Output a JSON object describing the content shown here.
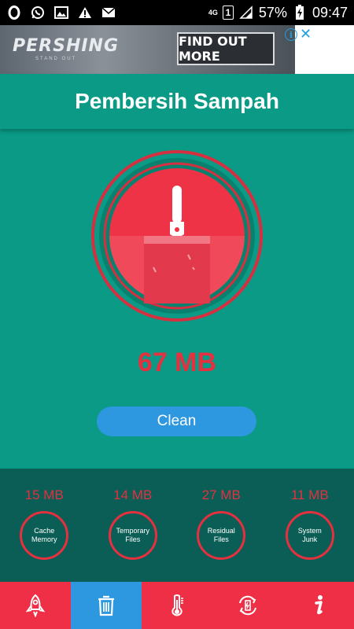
{
  "status_bar": {
    "left_icons": [
      "opera-icon",
      "whatsapp-icon",
      "gallery-icon",
      "warning-icon",
      "mail-icon"
    ],
    "network_type": "4G",
    "sim": "1",
    "battery_percent": "57%",
    "time": "09:47"
  },
  "ad": {
    "brand": "PERSHING",
    "tagline": "STAND OUT",
    "cta": "FIND OUT MORE",
    "info_icon": "info-icon",
    "close_icon": "close-icon"
  },
  "header": {
    "title": "Pembersih Sampah"
  },
  "main": {
    "junk_size": "67 MB",
    "clean_label": "Clean",
    "icon": "broom-icon"
  },
  "stats": [
    {
      "value": "15 MB",
      "label": "Cache Memory"
    },
    {
      "value": "14 MB",
      "label": "Temporary Files"
    },
    {
      "value": "27 MB",
      "label": "Residual Files"
    },
    {
      "value": "11 MB",
      "label": "System Junk"
    }
  ],
  "nav": {
    "items": [
      {
        "icon": "rocket-icon",
        "active": false
      },
      {
        "icon": "trash-icon",
        "active": true
      },
      {
        "icon": "thermometer-icon",
        "active": false
      },
      {
        "icon": "battery-refresh-icon",
        "active": false
      },
      {
        "icon": "info-icon",
        "active": false
      }
    ]
  },
  "colors": {
    "primary": "#0a9a86",
    "stats_bg": "#0b5e55",
    "accent_red": "#e53040",
    "nav_red": "#ef2f45",
    "blue": "#2d97e0"
  }
}
